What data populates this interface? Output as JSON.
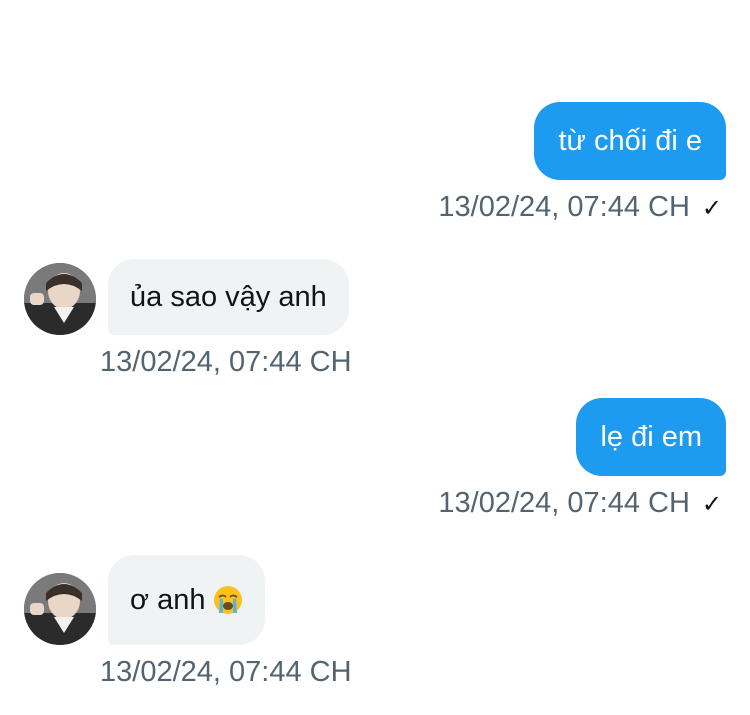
{
  "messages": [
    {
      "direction": "outgoing",
      "text": "từ chối đi e",
      "timestamp": "13/02/24, 07:44 CH",
      "status_icon": "check-icon",
      "status_glyph": "✓"
    },
    {
      "direction": "incoming",
      "text": "ủa sao vậy anh",
      "timestamp": "13/02/24, 07:44 CH",
      "avatar": "avatar-photo"
    },
    {
      "direction": "outgoing",
      "text": "lẹ đi em",
      "timestamp": "13/02/24, 07:44 CH",
      "status_icon": "check-icon",
      "status_glyph": "✓"
    },
    {
      "direction": "incoming",
      "text": "ơ anh",
      "emoji": "loudly-crying-face-emoji",
      "timestamp": "13/02/24, 07:44 CH",
      "avatar": "avatar-photo"
    }
  ],
  "colors": {
    "outgoing_bubble": "#1d9bf0",
    "incoming_bubble": "#eff3f4",
    "timestamp_text": "#536471"
  }
}
